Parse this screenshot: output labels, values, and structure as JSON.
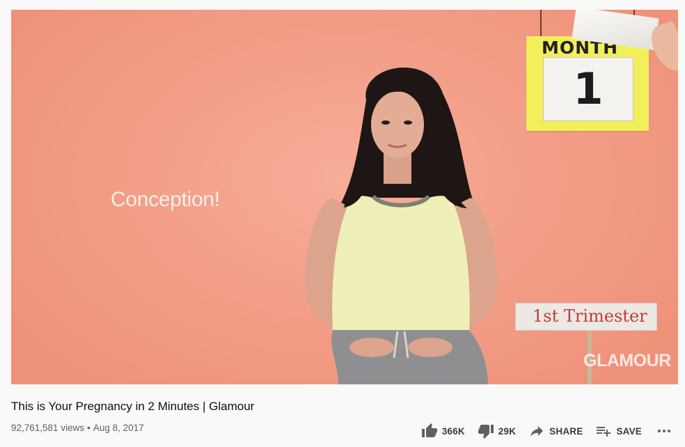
{
  "video": {
    "caption": "Conception!",
    "calendar_label": "MONTH",
    "calendar_number": "1",
    "trimester_sign": "1st Trimester",
    "watermark": "GLAMOUR",
    "background_color": "#f19b83"
  },
  "info": {
    "title": "This is Your Pregnancy in 2 Minutes | Glamour",
    "views": "92,761,581 views",
    "separator": "•",
    "date": "Aug 8, 2017"
  },
  "actions": {
    "like_count": "366K",
    "dislike_count": "29K",
    "share_label": "SHARE",
    "save_label": "SAVE",
    "icons": [
      "thumb-up-icon",
      "thumb-down-icon",
      "share-arrow-icon",
      "playlist-add-icon",
      "more-dots-icon"
    ]
  }
}
